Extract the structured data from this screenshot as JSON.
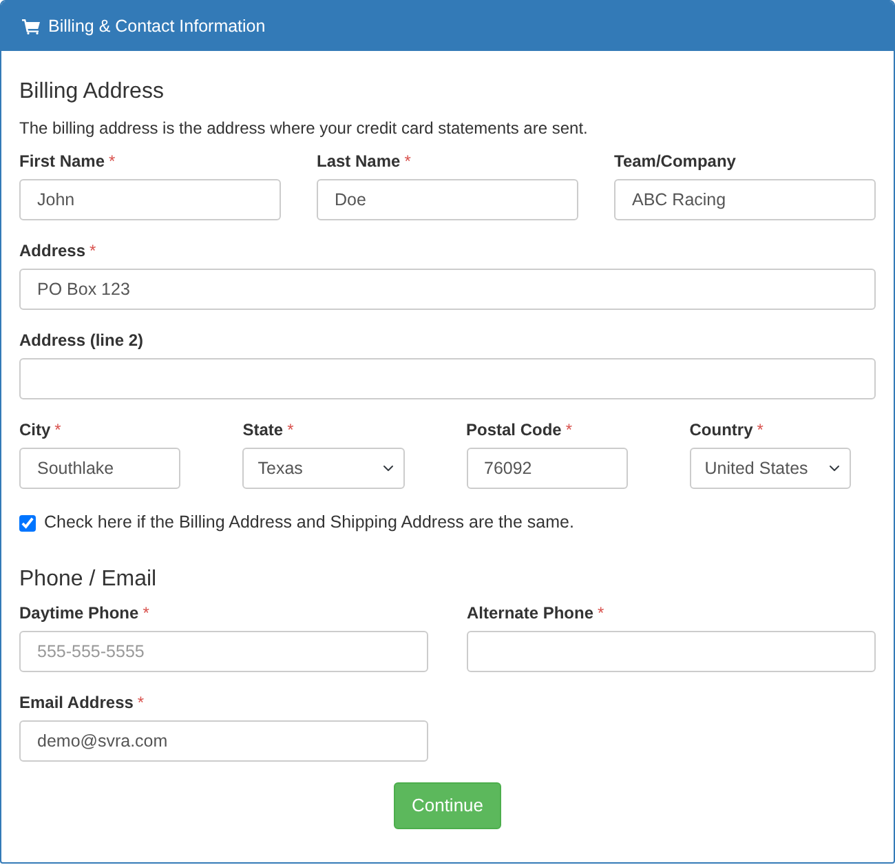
{
  "header": {
    "title": "Billing & Contact Information"
  },
  "sections": [
    {
      "heading": "Billing Address",
      "description": "The billing address is the address where your credit card statements are sent.",
      "rows": [
        {
          "kind": "thirds",
          "fields": [
            {
              "label": "First Name",
              "required_mark": "*",
              "kind": "text",
              "value": "John"
            },
            {
              "label": "Last Name",
              "required_mark": "*",
              "kind": "text",
              "value": "Doe"
            },
            {
              "label": "Team/Company",
              "kind": "text",
              "value": "ABC Racing"
            }
          ]
        },
        {
          "kind": "full",
          "fields": [
            {
              "label": "Address",
              "required_mark": "*",
              "kind": "text",
              "value": "PO Box 123"
            }
          ]
        },
        {
          "kind": "full",
          "fields": [
            {
              "label": "Address (line 2)",
              "kind": "text"
            }
          ]
        },
        {
          "kind": "quarters",
          "fields": [
            {
              "label": "City",
              "required_mark": "*",
              "kind": "text",
              "value": "Southlake"
            },
            {
              "label": "State",
              "required_mark": "*",
              "kind": "select",
              "value": "Texas"
            },
            {
              "label": "Postal Code",
              "required_mark": "*",
              "kind": "text",
              "value": "76092"
            },
            {
              "label": "Country",
              "required_mark": "*",
              "kind": "select",
              "value": "United States"
            }
          ]
        }
      ],
      "checkbox": {
        "label": "Check here if the Billing Address and Shipping Address are the same.",
        "checked": true
      }
    },
    {
      "heading": "Phone / Email",
      "rows": [
        {
          "kind": "halves",
          "fields": [
            {
              "label": "Daytime Phone",
              "required_mark": "*",
              "kind": "text",
              "placeholder": "555-555-5555"
            },
            {
              "label": "Alternate Phone",
              "required_mark": "*",
              "kind": "text"
            }
          ]
        },
        {
          "kind": "halves",
          "fields": [
            {
              "label": "Email Address",
              "required_mark": "*",
              "kind": "text",
              "value": "demo@svra.com"
            }
          ]
        }
      ]
    }
  ],
  "submit": {
    "label": "Continue"
  }
}
